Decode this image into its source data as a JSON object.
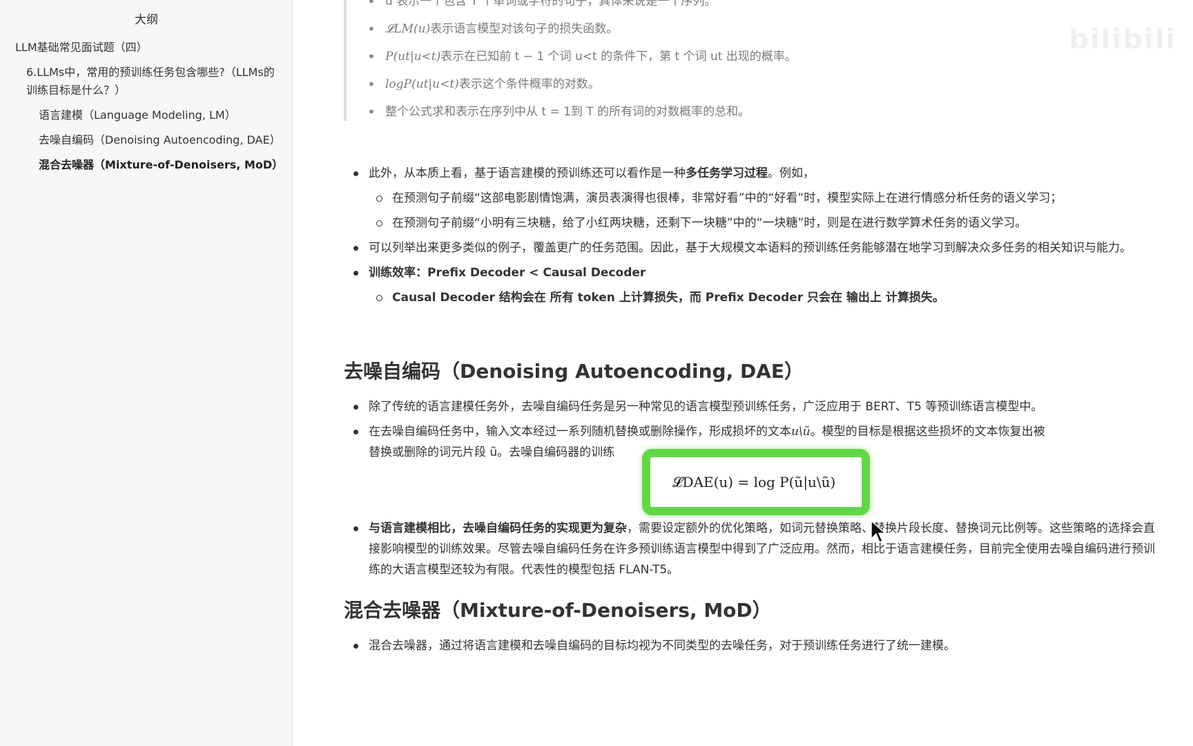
{
  "sidebar": {
    "title": "大纲",
    "items": [
      {
        "level": 1,
        "label": "LLM基础常见面试题（四）",
        "active": false
      },
      {
        "level": 2,
        "label": "6.LLMs中，常用的预训练任务包含哪些?（LLMs的训练目标是什么？）",
        "active": false
      },
      {
        "level": 3,
        "label": "语言建模（Language Modeling, LM）",
        "active": false
      },
      {
        "level": 3,
        "label": "去噪自编码（Denoising Autoencoding, DAE）",
        "active": false
      },
      {
        "level": 3,
        "label": "混合去噪器（Mixture-of-Denoisers, MoD）",
        "active": true
      }
    ]
  },
  "quote_items": [
    "u 表示一个包含 T 个单词或字符的句子，具体来说是一个序列。",
    "表示语言模型对该句子的损失函数。",
    "表示在已知前 t − 1 个词 u<t 的条件下，第 t 个词 ut 出现的概率。",
    "表示这个条件概率的对数。",
    "整个公式求和表示在序列中从 t = 1到 T 的所有词的对数概率的总和。"
  ],
  "quote_math": [
    "𝓛LM(u)",
    "P(ut|u<t)",
    "logP(ut|u<t)"
  ],
  "lm_section": {
    "b1_prefix": "此外，从本质上看，基于语言建模的预训练还可以看作是一种",
    "b1_strong": "多任务学习过程",
    "b1_suffix": "。例如，",
    "sub1": "在预测句子前缀“这部电影剧情饱满，演员表演得也很棒，非常好看”中的“好看”时，模型实际上在进行情感分析任务的语义学习；",
    "sub2": "在预测句子前缀“小明有三块糖，给了小红两块糖，还剩下一块糖”中的“一块糖”时，则是在进行数学算术任务的语义学习。",
    "b2": "可以列举出来更多类似的例子，覆盖更广的任务范围。因此，基于大规模文本语料的预训练任务能够潜在地学习到解决众多任务的相关知识与能力。",
    "b3": "训练效率：Prefix Decoder < Causal Decoder",
    "sub3": "Causal Decoder 结构会在 所有 token 上计算损失，而 Prefix Decoder 只会在 输出上 计算损失。"
  },
  "dae_section": {
    "heading": "去噪自编码（Denoising Autoencoding, DAE）",
    "b1": "除了传统的语言建模任务外，去噪自编码任务是另一种常见的语言模型预训练任务，广泛应用于 BERT、T5 等预训练语言模型中。",
    "b2_line1": "在去噪自编码任务中，输入文本经过一系列随机替换或删除操作，形成损坏的文本",
    "b2_line1_math": "u\\ũ",
    "b2_line1_end": "。模型的目标是根据这些损坏的文本恢复出被",
    "b2_line2": "替换或删除的词元片段 ũ。去噪自编码器的训练",
    "formula": "𝓛DAE(u) = log P(ũ|u\\ũ)",
    "b3_strong": "与语言建模相比，去噪自编码任务的实现更为复杂",
    "b3_rest": "，需要设定额外的优化策略，如词元替换策略、替换片段长度、替换词元比例等。这些策略的选择会直接影响模型的训练效果。尽管去噪自编码任务在许多预训练语言模型中得到了广泛应用。然而，相比于语言建模任务，目前完全使用去噪自编码进行预训练的大语言模型还较为有限。代表性的模型包括 FLAN-T5。"
  },
  "mod_section": {
    "heading": "混合去噪器（Mixture-of-Denoisers, MoD）",
    "b1": "混合去噪器，通过将语言建模和去噪自编码的目标均视为不同类型的去噪任务，对于预训练任务进行了统一建模。"
  },
  "watermark": "bilibili",
  "colors": {
    "highlight": "#62d746",
    "sidebar_bg": "#f7f7f7"
  }
}
